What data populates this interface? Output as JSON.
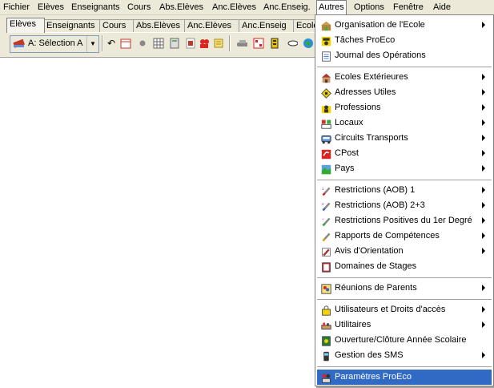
{
  "menubar": {
    "items": [
      "Fichier",
      "Elèves",
      "Enseignants",
      "Cours",
      "Abs.Elèves",
      "Anc.Elèves",
      "Anc.Enseig.",
      "Autres",
      "Options",
      "Fenêtre",
      "Aide"
    ]
  },
  "tabs": [
    "Elèves",
    "Enseignants",
    "Cours",
    "Abs.Elèves",
    "Anc.Elèves",
    "Anc.Enseig",
    "Ecole"
  ],
  "toolbar": {
    "combo_value": "A: Sélection A"
  },
  "dropdown": {
    "items": [
      {
        "label": "Organisation de l'Ecole",
        "icon": "school-organisation-icon",
        "submenu": true
      },
      {
        "label": "Tâches ProEco",
        "icon": "tasks-icon",
        "submenu": false
      },
      {
        "label": "Journal des Opérations",
        "icon": "journal-icon",
        "submenu": false
      },
      {
        "label": "Ecoles Extérieures",
        "icon": "external-school-icon",
        "submenu": true
      },
      {
        "label": "Adresses Utiles",
        "icon": "addresses-icon",
        "submenu": true
      },
      {
        "label": "Professions",
        "icon": "professions-icon",
        "submenu": true
      },
      {
        "label": "Locaux",
        "icon": "rooms-icon",
        "submenu": true
      },
      {
        "label": "Circuits Transports",
        "icon": "bus-icon",
        "submenu": true
      },
      {
        "label": "CPost",
        "icon": "cpost-icon",
        "submenu": true
      },
      {
        "label": "Pays",
        "icon": "country-icon",
        "submenu": true
      },
      {
        "label": "Restrictions (AOB) 1",
        "icon": "restrictions-1-icon",
        "submenu": true
      },
      {
        "label": "Restrictions (AOB) 2+3",
        "icon": "restrictions-2-icon",
        "submenu": true
      },
      {
        "label": "Restrictions Positives du 1er Degré",
        "icon": "restrictions-positive-icon",
        "submenu": true
      },
      {
        "label": "Rapports de Compétences",
        "icon": "competence-report-icon",
        "submenu": true
      },
      {
        "label": "Avis d'Orientation",
        "icon": "orientation-icon",
        "submenu": true
      },
      {
        "label": "Domaines de Stages",
        "icon": "internship-domain-icon",
        "submenu": false
      },
      {
        "label": "Réunions de Parents",
        "icon": "parents-meeting-icon",
        "submenu": true
      },
      {
        "label": "Utilisateurs et Droits d'accès",
        "icon": "users-rights-icon",
        "submenu": true
      },
      {
        "label": "Utilitaires",
        "icon": "utilities-icon",
        "submenu": true
      },
      {
        "label": "Ouverture/Clôture Année Scolaire",
        "icon": "school-year-icon",
        "submenu": false
      },
      {
        "label": "Gestion des SMS",
        "icon": "sms-phone-icon",
        "submenu": true
      },
      {
        "label": "Paramètres ProEco",
        "icon": "settings-people-icon",
        "submenu": false
      }
    ]
  },
  "colors": {
    "highlight": "#316ac5",
    "menubar_bg": "#ece9d8"
  }
}
